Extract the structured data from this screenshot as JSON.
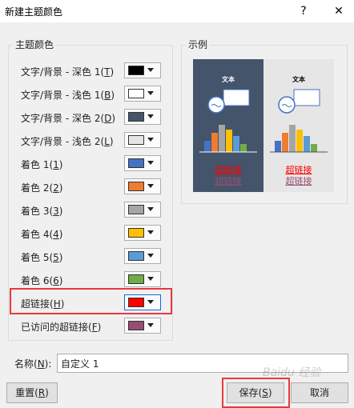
{
  "window": {
    "title": "新建主题颜色",
    "help": "?",
    "close": "✕"
  },
  "theme_group": {
    "legend": "主题颜色",
    "rows": [
      {
        "label_pre": "文字/背景 - 深色 1(",
        "key": "T",
        "label_post": ")",
        "color": "#000000"
      },
      {
        "label_pre": "文字/背景 - 浅色 1(",
        "key": "B",
        "label_post": ")",
        "color": "#ffffff"
      },
      {
        "label_pre": "文字/背景 - 深色 2(",
        "key": "D",
        "label_post": ")",
        "color": "#44546a"
      },
      {
        "label_pre": "文字/背景 - 浅色 2(",
        "key": "L",
        "label_post": ")",
        "color": "#e7e6e6"
      },
      {
        "label_pre": "着色 1(",
        "key": "1",
        "label_post": ")",
        "color": "#4472c4"
      },
      {
        "label_pre": "着色 2(",
        "key": "2",
        "label_post": ")",
        "color": "#ed7d31"
      },
      {
        "label_pre": "着色 3(",
        "key": "3",
        "label_post": ")",
        "color": "#a5a5a5"
      },
      {
        "label_pre": "着色 4(",
        "key": "4",
        "label_post": ")",
        "color": "#ffc000"
      },
      {
        "label_pre": "着色 5(",
        "key": "5",
        "label_post": ")",
        "color": "#5b9bd5"
      },
      {
        "label_pre": "着色 6(",
        "key": "6",
        "label_post": ")",
        "color": "#70ad47"
      },
      {
        "label_pre": "超链接(",
        "key": "H",
        "label_post": ")",
        "color": "#ff0000"
      },
      {
        "label_pre": "已访问的超链接(",
        "key": "F",
        "label_post": ")",
        "color": "#954f72"
      }
    ]
  },
  "sample_group": {
    "legend": "示例",
    "dark_panel": {
      "text": "文本",
      "link": "超链接",
      "visited": "超链接",
      "bg": "#44546a"
    },
    "light_panel": {
      "text": "文本",
      "link": "超链接",
      "visited": "超链接",
      "bg": "#e7e6e6"
    }
  },
  "name_field": {
    "label_pre": "名称(",
    "key": "N",
    "label_post": "):",
    "value": "自定义 1"
  },
  "buttons": {
    "reset_pre": "重置(",
    "reset_key": "R",
    "reset_post": ")",
    "save_pre": "保存(",
    "save_key": "S",
    "save_post": ")",
    "cancel": "取消"
  },
  "watermark": "Baidu 经验"
}
